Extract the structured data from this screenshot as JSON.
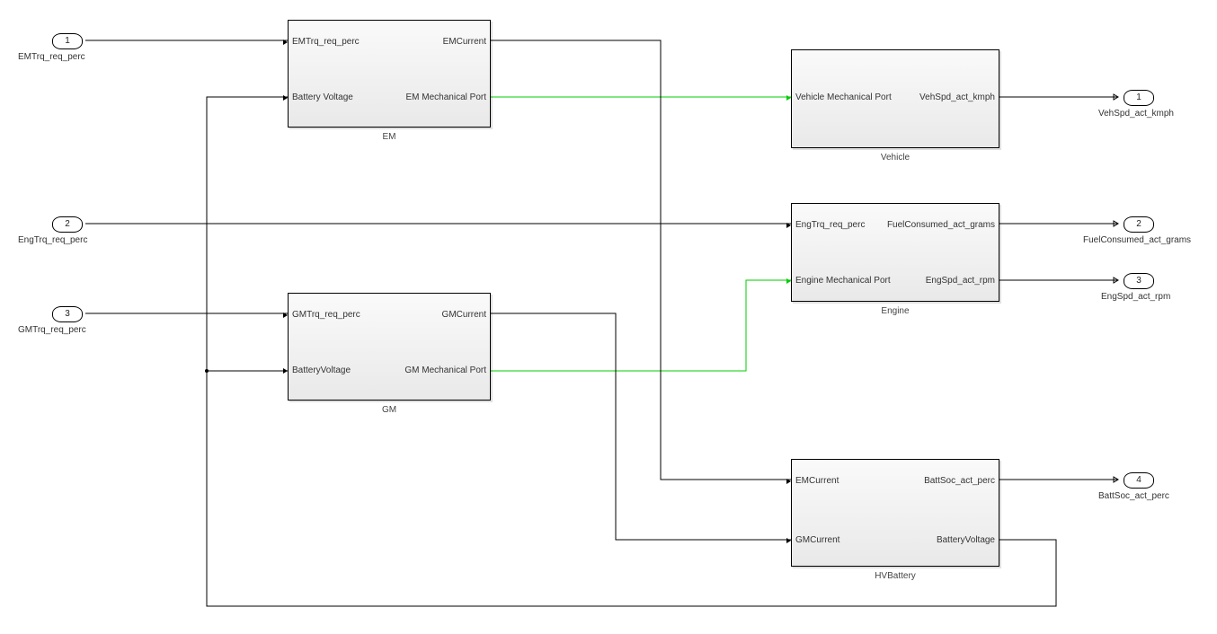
{
  "inports": {
    "p1": {
      "num": "1",
      "label": "EMTrq_req_perc"
    },
    "p2": {
      "num": "2",
      "label": "EngTrq_req_perc"
    },
    "p3": {
      "num": "3",
      "label": "GMTrq_req_perc"
    }
  },
  "outports": {
    "o1": {
      "num": "1",
      "label": "VehSpd_act_kmph"
    },
    "o2": {
      "num": "2",
      "label": "FuelConsumed_act_grams"
    },
    "o3": {
      "num": "3",
      "label": "EngSpd_act_rpm"
    },
    "o4": {
      "num": "4",
      "label": "BattSoc_act_perc"
    }
  },
  "blocks": {
    "em": {
      "name": "EM",
      "in1": "EMTrq_req_perc",
      "in2": "Battery Voltage",
      "out1": "EMCurrent",
      "out2": "EM Mechanical Port"
    },
    "gm": {
      "name": "GM",
      "in1": "GMTrq_req_perc",
      "in2": "BatteryVoltage",
      "out1": "GMCurrent",
      "out2": "GM Mechanical Port"
    },
    "vehicle": {
      "name": "Vehicle",
      "in1": "Vehicle Mechanical Port",
      "out1": "VehSpd_act_kmph"
    },
    "engine": {
      "name": "Engine",
      "in1": "EngTrq_req_perc",
      "in2": "Engine Mechanical Port",
      "out1": "FuelConsumed_act_grams",
      "out2": "EngSpd_act_rpm"
    },
    "battery": {
      "name": "HVBattery",
      "in1": "EMCurrent",
      "in2": "GMCurrent",
      "out1": "BattSoc_act_perc",
      "out2": "BatteryVoltage"
    }
  }
}
